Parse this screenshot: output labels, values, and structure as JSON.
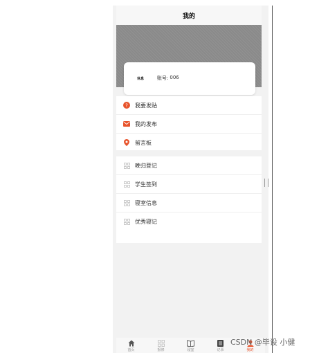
{
  "header": {
    "title": "我的"
  },
  "profile": {
    "avatar_text": "休息",
    "account_label": "账号:",
    "account_value": "006"
  },
  "menu_primary": [
    {
      "label": "我要发贴",
      "icon": "question-circle-icon",
      "color": "#e8542c"
    },
    {
      "label": "我的发布",
      "icon": "mail-icon",
      "color": "#e8542c"
    },
    {
      "label": "留言板",
      "icon": "location-pin-icon",
      "color": "#e8542c"
    }
  ],
  "menu_secondary": [
    {
      "label": "晚归登记",
      "icon": "grid-icon"
    },
    {
      "label": "学生签到",
      "icon": "grid-icon"
    },
    {
      "label": "寝室信息",
      "icon": "grid-icon"
    },
    {
      "label": "优秀寝记",
      "icon": "grid-icon"
    }
  ],
  "tabbar": [
    {
      "label": "首页",
      "icon": "home-icon"
    },
    {
      "label": "报修",
      "icon": "grid-icon"
    },
    {
      "label": "寝室",
      "icon": "book-icon"
    },
    {
      "label": "记事",
      "icon": "document-icon"
    },
    {
      "label": "我的",
      "icon": "user-icon",
      "active": true
    }
  ],
  "watermark": "CSDN @毕设 小健",
  "colors": {
    "accent": "#e8542c",
    "banner": "#8a8a8a",
    "background": "#f2f2f2"
  }
}
